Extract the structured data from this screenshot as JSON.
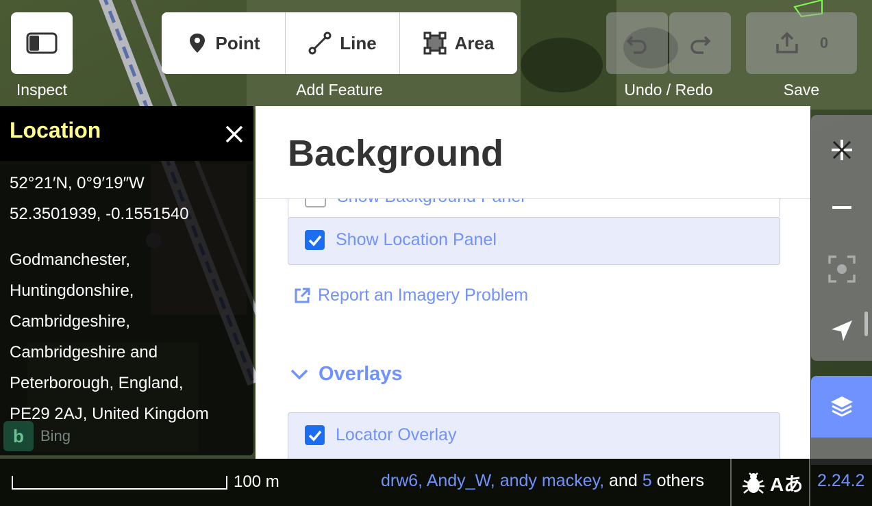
{
  "toolbar": {
    "inspect_label": "Inspect",
    "add_feature_label": "Add Feature",
    "point_label": "Point",
    "line_label": "Line",
    "area_label": "Area",
    "undo_redo_label": "Undo / Redo",
    "save_label": "Save",
    "save_count": "0"
  },
  "location_panel": {
    "title": "Location",
    "dms": "52°21′N, 0°9′19″W",
    "decimal": "52.3501939, -0.1551540",
    "address_lines": [
      "Godmanchester,",
      "Huntingdonshire,",
      "Cambridgeshire,",
      "Cambridgeshire and",
      "Peterborough, England,",
      "PE29 2AJ, United Kingdom"
    ]
  },
  "background_pane": {
    "title": "Background",
    "partial_option": "Show Background Panel",
    "location_option": "Show Location Panel",
    "report_link": "Report an Imagery Problem",
    "overlays_heading": "Overlays",
    "locator_overlay": "Locator Overlay"
  },
  "footer": {
    "scale_label": "100 m",
    "attribution_names": "drw6, Andy_W, andy mackey,",
    "attribution_and": "and",
    "attribution_count": "5",
    "attribution_others": "others",
    "version": "2.24.2",
    "imagery_name": "Bing"
  },
  "colors": {
    "accent": "#7092ff",
    "location_title": "#fffc8c",
    "checkbox": "#1c6ef0"
  }
}
